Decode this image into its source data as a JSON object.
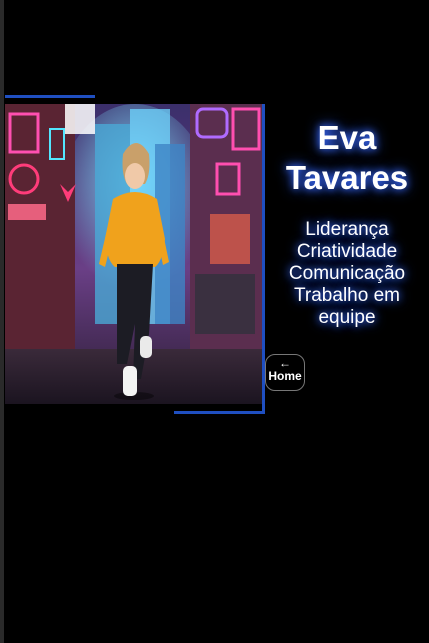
{
  "profile": {
    "name": "Eva Tavares",
    "skills": [
      "Liderança",
      "Criatividade",
      "Comunicação",
      "Trabalho em equipe"
    ]
  },
  "nav": {
    "home_label": "Home",
    "home_icon": "arrow-left-icon"
  },
  "colors": {
    "background": "#000000",
    "frame_accent": "#1f4fc1",
    "text_glow": "#3b6cff"
  }
}
